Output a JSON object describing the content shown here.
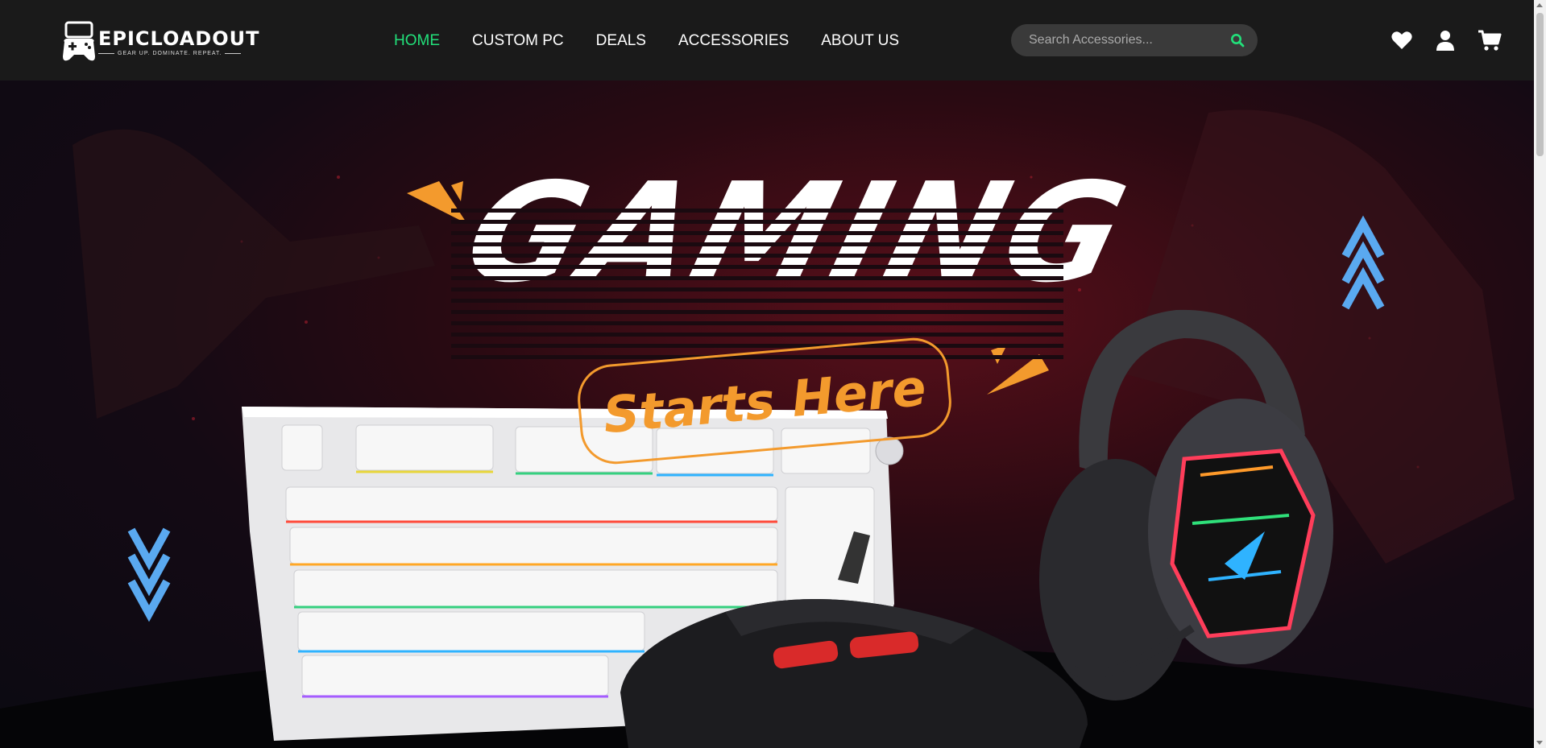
{
  "brand": {
    "name": "EPICLOADOUT",
    "tagline": "GEAR UP. DOMINATE. REPEAT."
  },
  "nav": {
    "items": [
      {
        "label": "HOME",
        "active": true
      },
      {
        "label": "CUSTOM PC",
        "active": false
      },
      {
        "label": "DEALS",
        "active": false
      },
      {
        "label": "ACCESSORIES",
        "active": false
      },
      {
        "label": "ABOUT US",
        "active": false
      }
    ]
  },
  "search": {
    "placeholder": "Search Accessories...",
    "icon": "search-icon"
  },
  "header_icons": [
    "heart-icon",
    "user-icon",
    "cart-icon"
  ],
  "hero": {
    "headline": "GAMING",
    "tagline": "Starts Here",
    "products": [
      "keyboard",
      "mouse",
      "headset"
    ]
  },
  "colors": {
    "accent": "#22e07a",
    "orange": "#f39a2d",
    "arrow_blue": "#5aa9f0",
    "header_bg": "#1a1a1a"
  }
}
